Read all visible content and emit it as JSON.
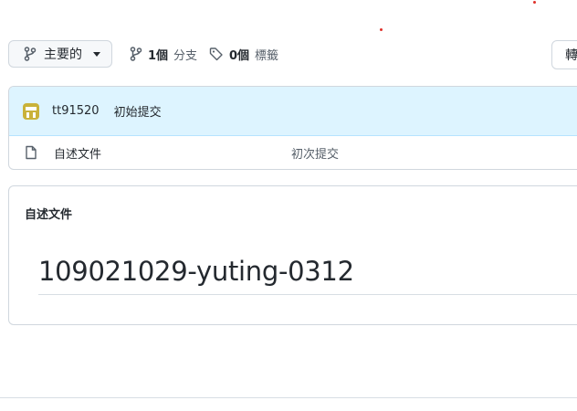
{
  "toolbar": {
    "branch_label": "主要的",
    "branches_count": "1個",
    "branches_label": "分支",
    "tags_count": "0個",
    "tags_label": "標籤",
    "right_button_label": "轉"
  },
  "commit": {
    "author": "tt91520",
    "message": "初始提交"
  },
  "files": [
    {
      "name": "自述文件",
      "commit": "初次提交"
    }
  ],
  "readme": {
    "title": "自述文件",
    "heading": "109021029-yuting-0312"
  },
  "colors": {
    "commit_bg": "#ddf4ff",
    "border": "#d0d7de",
    "avatar": "#c9b23a"
  }
}
